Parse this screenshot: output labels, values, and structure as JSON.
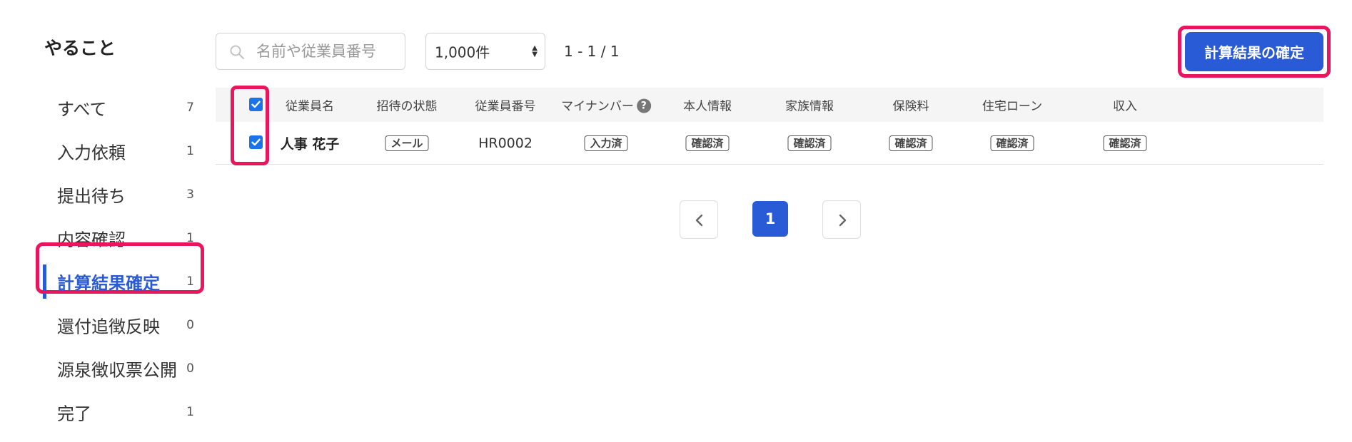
{
  "sidebar": {
    "title": "やること",
    "active_index": 4,
    "items": [
      {
        "label": "すべて",
        "count": "7"
      },
      {
        "label": "入力依頼",
        "count": "1"
      },
      {
        "label": "提出待ち",
        "count": "3"
      },
      {
        "label": "内容確認",
        "count": "1"
      },
      {
        "label": "計算結果確定",
        "count": "1"
      },
      {
        "label": "還付追徴反映",
        "count": "0"
      },
      {
        "label": "源泉徴収票公開",
        "count": "0"
      },
      {
        "label": "完了",
        "count": "1"
      }
    ]
  },
  "toolbar": {
    "search_placeholder": "名前や従業員番号",
    "search_value": "",
    "per_page": "1,000件",
    "range": "1 - 1 / 1",
    "confirm_label": "計算結果の確定"
  },
  "table": {
    "headers": {
      "name": "従業員名",
      "invite": "招待の状態",
      "number": "従業員番号",
      "mynumber": "マイナンバー",
      "personal": "本人情報",
      "family": "家族情報",
      "insurance": "保険料",
      "loan": "住宅ローン",
      "income": "収入"
    },
    "select_all_checked": true,
    "rows": [
      {
        "checked": true,
        "name": "人事 花子",
        "invite": "メール",
        "number": "HR0002",
        "mynumber": "入力済",
        "personal": "確認済",
        "family": "確認済",
        "insurance": "確認済",
        "loan": "確認済",
        "income": "確認済"
      }
    ]
  },
  "pagination": {
    "current": "1"
  },
  "colors": {
    "accent": "#2a5bd7",
    "highlight": "#e8175d",
    "checkbox": "#1a73e8"
  }
}
